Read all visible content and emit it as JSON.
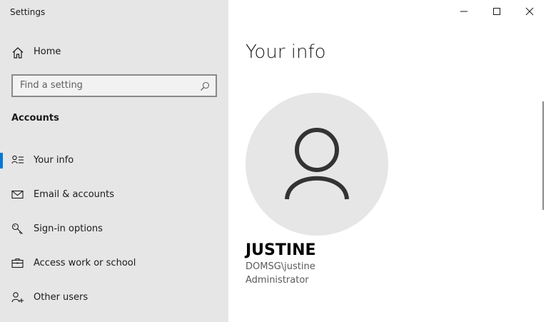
{
  "window": {
    "title": "Settings"
  },
  "sidebar": {
    "home_label": "Home",
    "search": {
      "placeholder": "Find a setting"
    },
    "section_title": "Accounts",
    "items": [
      {
        "label": "Your info",
        "icon": "contact-info-icon",
        "selected": true
      },
      {
        "label": "Email & accounts",
        "icon": "mail-icon",
        "selected": false
      },
      {
        "label": "Sign-in options",
        "icon": "key-icon",
        "selected": false
      },
      {
        "label": "Access work or school",
        "icon": "briefcase-icon",
        "selected": false
      },
      {
        "label": "Other users",
        "icon": "add-user-icon",
        "selected": false
      }
    ]
  },
  "main": {
    "title": "Your info",
    "user": {
      "name": "JUSTINE",
      "account": "DOMSG\\justine",
      "role": "Administrator"
    }
  },
  "colors": {
    "accent": "#0078d7",
    "sidebar_bg": "#e6e6e6",
    "avatar_bg": "#e6e6e6"
  }
}
